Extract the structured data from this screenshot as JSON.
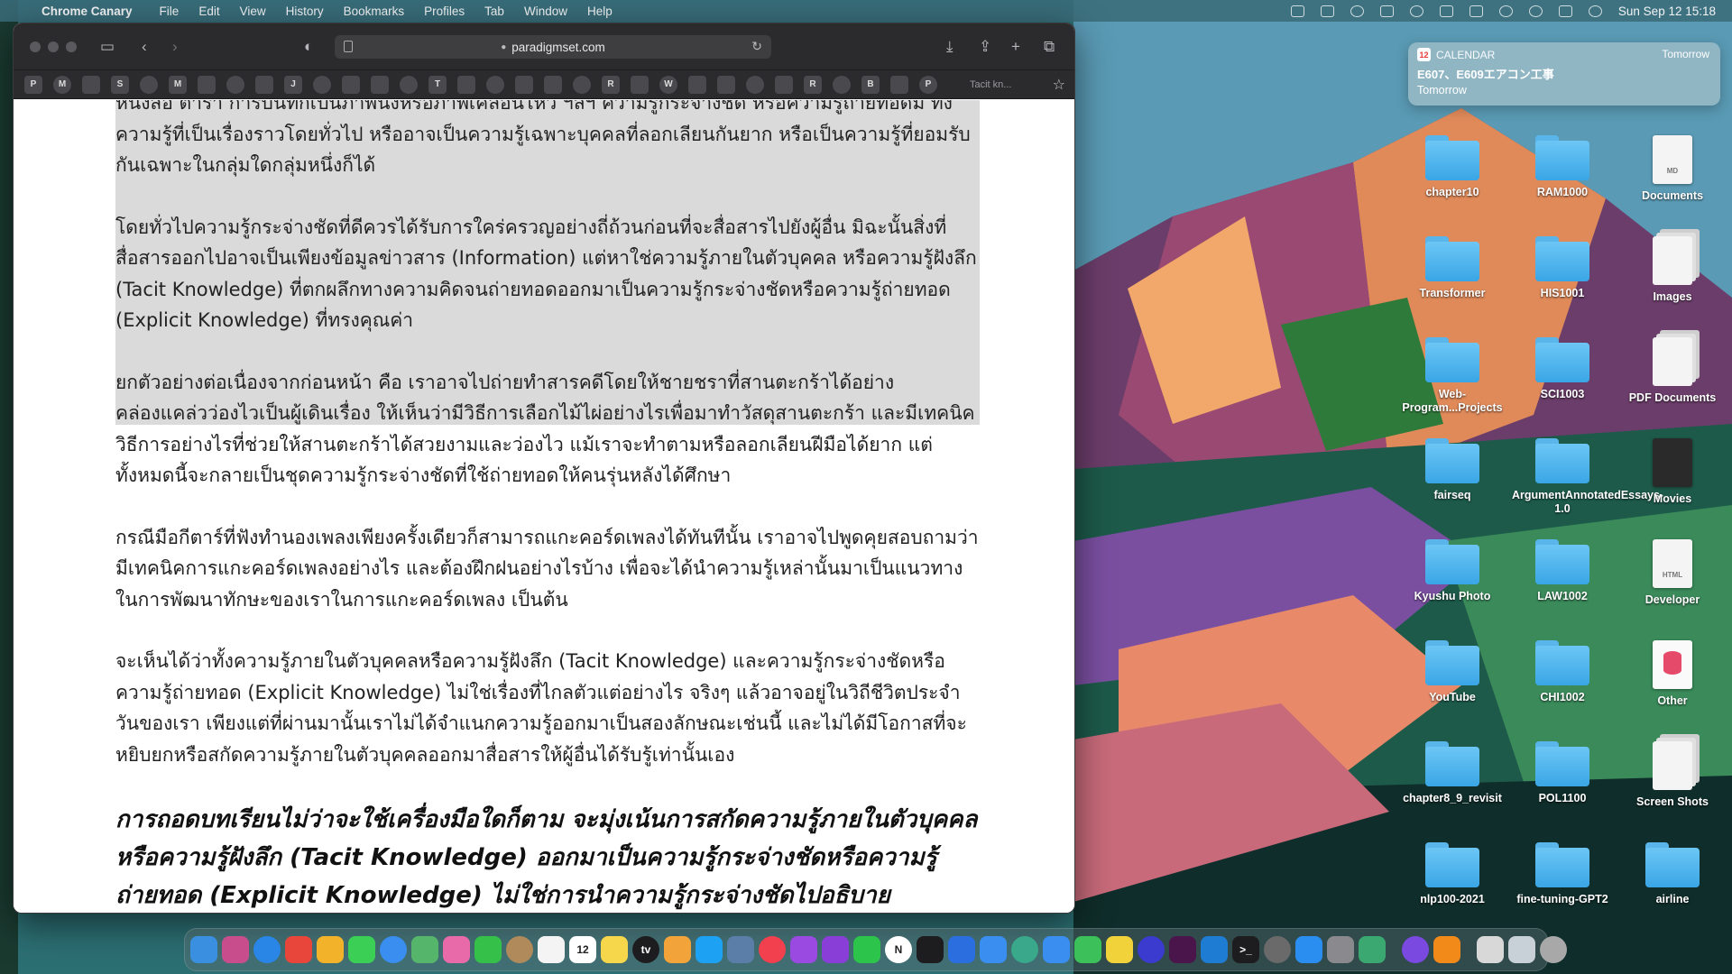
{
  "menubar": {
    "app_name": "Chrome Canary",
    "items": [
      "File",
      "Edit",
      "View",
      "History",
      "Bookmarks",
      "Profiles",
      "Tab",
      "Window",
      "Help"
    ],
    "clock": "Sun Sep 12  15:18"
  },
  "browser": {
    "url": "paradigmset.com",
    "bookmark_glyphs": [
      "P",
      "M",
      "",
      "S",
      "",
      "M",
      "",
      "",
      "",
      "J",
      "",
      "",
      "",
      "",
      "T",
      "",
      "",
      "",
      "",
      "",
      "R",
      "",
      "W",
      "",
      "",
      "",
      "",
      "R",
      "",
      "B",
      "",
      "P"
    ],
    "tab_title": "Tacit kn...",
    "paragraphs": [
      "หนังสือ ตารา การบันทึกเป็นภาพนิ่งหรือภาพเคลื่อนไหว ฯลฯ ความรู้กระจ่างชัด หรือความรู้ถ่ายทอดมี ทั้งความรู้ที่เป็นเรื่องราวโดยทั่วไป หรืออาจเป็นความรู้เฉพาะบุคคลที่ลอกเลียนกันยาก หรือเป็นความรู้ที่ยอมรับกันเฉพาะในกลุ่มใดกลุ่มหนึ่งก็ได้",
      "โดยทั่วไปความรู้กระจ่างชัดที่ดีควรได้รับการใคร่ครวญอย่างถี่ถ้วนก่อนที่จะสื่อสารไปยังผู้อื่น มิฉะนั้นสิ่งที่สื่อสารออกไปอาจเป็นเพียงข้อมูลข่าวสาร (Information) แต่หาใช่ความรู้ภายในตัวบุคคล หรือความรู้ฝังลึก (Tacit Knowledge) ที่ตกผลึกทางความคิดจนถ่ายทอดออกมาเป็นความรู้กระจ่างชัดหรือความรู้ถ่ายทอด (Explicit Knowledge) ที่ทรงคุณค่า",
      "ยกตัวอย่างต่อเนื่องจากก่อนหน้า คือ เราอาจไปถ่ายทำสารคดีโดยให้ชายชราที่สานตะกร้าได้อย่างคล่องแคล่วว่องไวเป็นผู้เดินเรื่อง ให้เห็นว่ามีวิธีการเลือกไม้ไผ่อย่างไรเพื่อมาทำวัสดุสานตะกร้า และมีเทคนิควิธีการอย่างไรที่ช่วยให้สานตะกร้าได้สวยงามและว่องไว แม้เราจะทำตามหรือลอกเลียนฝีมือได้ยาก แต่ทั้งหมดนี้จะกลายเป็นชุดความรู้กระจ่างชัดที่ใช้ถ่ายทอดให้คนรุ่นหลังได้ศึกษา",
      "กรณีมือกีตาร์ที่ฟังทำนองเพลงเพียงครั้งเดียวก็สามารถแกะคอร์ดเพลงได้ทันทีนั้น เราอาจไปพูดคุยสอบถามว่ามีเทคนิคการแกะคอร์ดเพลงอย่างไร และต้องฝึกฝนอย่างไรบ้าง เพื่อจะได้นำความรู้เหล่านั้นมาเป็นแนวทางในการพัฒนาทักษะของเราในการแกะคอร์ดเพลง เป็นต้น",
      "จะเห็นได้ว่าทั้งความรู้ภายในตัวบุคคลหรือความรู้ฝังลึก (Tacit Knowledge) และความรู้กระจ่างชัดหรือความรู้ถ่ายทอด (Explicit Knowledge) ไม่ใช่เรื่องที่ไกลตัวแต่อย่างไร จริงๆ แล้วอาจอยู่ในวิถีชีวิตประจำวันของเรา เพียงแต่ที่ผ่านมานั้นเราไม่ได้จำแนกความรู้ออกมาเป็นสองลักษณะเช่นนี้ และไม่ได้มีโอกาสที่จะหยิบยกหรือสกัดความรู้ภายในตัวบุคคลออกมาสื่อสารให้ผู้อื่นได้รับรู้เท่านั้นเอง"
    ],
    "lead_paragraph": "การถอดบทเรียนไม่ว่าจะใช้เครื่องมือใดก็ตาม จะมุ่งเน้นการสกัดความรู้ภายในตัวบุคคลหรือความรู้ฝังลึก (Tacit Knowledge) ออกมาเป็นความรู้กระจ่างชัดหรือความรู้ถ่ายทอด (Explicit Knowledge) ไม่ใช่การนำความรู้กระจ่างชัดไปอธิบาย"
  },
  "notification": {
    "app": "CALENDAR",
    "when": "Tomorrow",
    "title": "E607、E609エアコン工事",
    "subtitle": "Tomorrow",
    "icon_text": "12"
  },
  "desktop": {
    "items": [
      {
        "label": "chapter10",
        "kind": "folder"
      },
      {
        "label": "RAM1000",
        "kind": "folder"
      },
      {
        "label": "Documents",
        "kind": "doc",
        "tag": "MD"
      },
      {
        "label": "Transformer",
        "kind": "folder"
      },
      {
        "label": "HIS1001",
        "kind": "folder"
      },
      {
        "label": "Images",
        "kind": "stack"
      },
      {
        "label": "Web-Program...Projects",
        "kind": "folder"
      },
      {
        "label": "SCI1003",
        "kind": "folder"
      },
      {
        "label": "PDF Documents",
        "kind": "stack"
      },
      {
        "label": "fairseq",
        "kind": "folder"
      },
      {
        "label": "ArgumentAnnotatedEssays-1.0",
        "kind": "folder"
      },
      {
        "label": "Movies",
        "kind": "dark"
      },
      {
        "label": "Kyushu Photo",
        "kind": "folder"
      },
      {
        "label": "LAW1002",
        "kind": "folder"
      },
      {
        "label": "Developer",
        "kind": "doc",
        "tag": "HTML"
      },
      {
        "label": "YouTube",
        "kind": "folder"
      },
      {
        "label": "CHI1002",
        "kind": "folder"
      },
      {
        "label": "Other",
        "kind": "db"
      },
      {
        "label": "chapter8_9_revisit",
        "kind": "folder"
      },
      {
        "label": "POL1100",
        "kind": "folder"
      },
      {
        "label": "Screen Shots",
        "kind": "stack"
      },
      {
        "label": "nlp100-2021",
        "kind": "folder"
      },
      {
        "label": "fine-tuning-GPT2",
        "kind": "folder"
      },
      {
        "label": "airline",
        "kind": "folder"
      }
    ]
  },
  "dock": {
    "apps": [
      {
        "name": "finder-icon",
        "color": "#3b8fe0",
        "glyph": ""
      },
      {
        "name": "launchpad-icon",
        "color": "#c84d8c",
        "glyph": ""
      },
      {
        "name": "safari-icon",
        "color": "#2a86e6",
        "glyph": ""
      },
      {
        "name": "chrome-icon",
        "color": "#e8463a",
        "glyph": ""
      },
      {
        "name": "chrome-canary-icon",
        "color": "#f2b32a",
        "glyph": ""
      },
      {
        "name": "messages-icon",
        "color": "#3ccf55",
        "glyph": ""
      },
      {
        "name": "mail-icon",
        "color": "#3a8ef0",
        "glyph": ""
      },
      {
        "name": "maps-icon",
        "color": "#55b56a",
        "glyph": ""
      },
      {
        "name": "photos-icon",
        "color": "#e86aa8",
        "glyph": ""
      },
      {
        "name": "facetime-icon",
        "color": "#35c04a",
        "glyph": ""
      },
      {
        "name": "contacts-icon",
        "color": "#b08a5a",
        "glyph": ""
      },
      {
        "name": "reminders-icon",
        "color": "#f4f4f4",
        "glyph": ""
      },
      {
        "name": "calendar-icon",
        "color": "#ffffff",
        "glyph": "12"
      },
      {
        "name": "notes-icon",
        "color": "#f6d64a",
        "glyph": ""
      },
      {
        "name": "apple-tv-icon",
        "color": "#1d1d1f",
        "glyph": "tv"
      },
      {
        "name": "pages-icon",
        "color": "#f2a33a",
        "glyph": ""
      },
      {
        "name": "twitter-icon",
        "color": "#1da1f2",
        "glyph": ""
      },
      {
        "name": "preview-icon",
        "color": "#5a7ea8",
        "glyph": ""
      },
      {
        "name": "music-icon",
        "color": "#f2404f",
        "glyph": ""
      },
      {
        "name": "podcasts-icon",
        "color": "#9a4ae0",
        "glyph": ""
      },
      {
        "name": "podcast-alt-icon",
        "color": "#8a3ed8",
        "glyph": ""
      },
      {
        "name": "line-icon",
        "color": "#2cc44a",
        "glyph": ""
      },
      {
        "name": "notion-icon",
        "color": "#ffffff",
        "glyph": "N"
      },
      {
        "name": "binance-icon",
        "color": "#1d1d1f",
        "glyph": ""
      },
      {
        "name": "vpn-icon",
        "color": "#2a6ee0",
        "glyph": ""
      },
      {
        "name": "sync-icon",
        "color": "#3a8ef0",
        "glyph": ""
      },
      {
        "name": "chatgpt-icon",
        "color": "#3aa88a",
        "glyph": ""
      },
      {
        "name": "keynote-icon",
        "color": "#3a8ef0",
        "glyph": ""
      },
      {
        "name": "numbers-icon",
        "color": "#3cc05a",
        "glyph": ""
      },
      {
        "name": "pen-icon",
        "color": "#f2d23a",
        "glyph": ""
      },
      {
        "name": "screen-icon",
        "color": "#3b3bd0",
        "glyph": ""
      },
      {
        "name": "slack-icon",
        "color": "#4a154b",
        "glyph": ""
      },
      {
        "name": "vscode-icon",
        "color": "#1e7cd2",
        "glyph": ""
      },
      {
        "name": "terminal-icon",
        "color": "#1d1d1f",
        "glyph": ">_"
      },
      {
        "name": "gimp-icon",
        "color": "#6a6a6a",
        "glyph": ""
      },
      {
        "name": "app-store-icon",
        "color": "#2a8ef0",
        "glyph": ""
      },
      {
        "name": "system-preferences-icon",
        "color": "#8a8a8e",
        "glyph": ""
      },
      {
        "name": "anaconda-icon",
        "color": "#3aa870",
        "glyph": ""
      },
      {
        "name": "github-icon",
        "color": "#7a4ae0",
        "glyph": ""
      },
      {
        "name": "vlc-icon",
        "color": "#f28a1a",
        "glyph": ""
      },
      {
        "name": "documents-stack-icon",
        "color": "#d8d8d8",
        "glyph": ""
      },
      {
        "name": "downloads-stack-icon",
        "color": "#c8d0d8",
        "glyph": ""
      },
      {
        "name": "trash-icon",
        "color": "#a8a8a8",
        "glyph": ""
      }
    ]
  }
}
